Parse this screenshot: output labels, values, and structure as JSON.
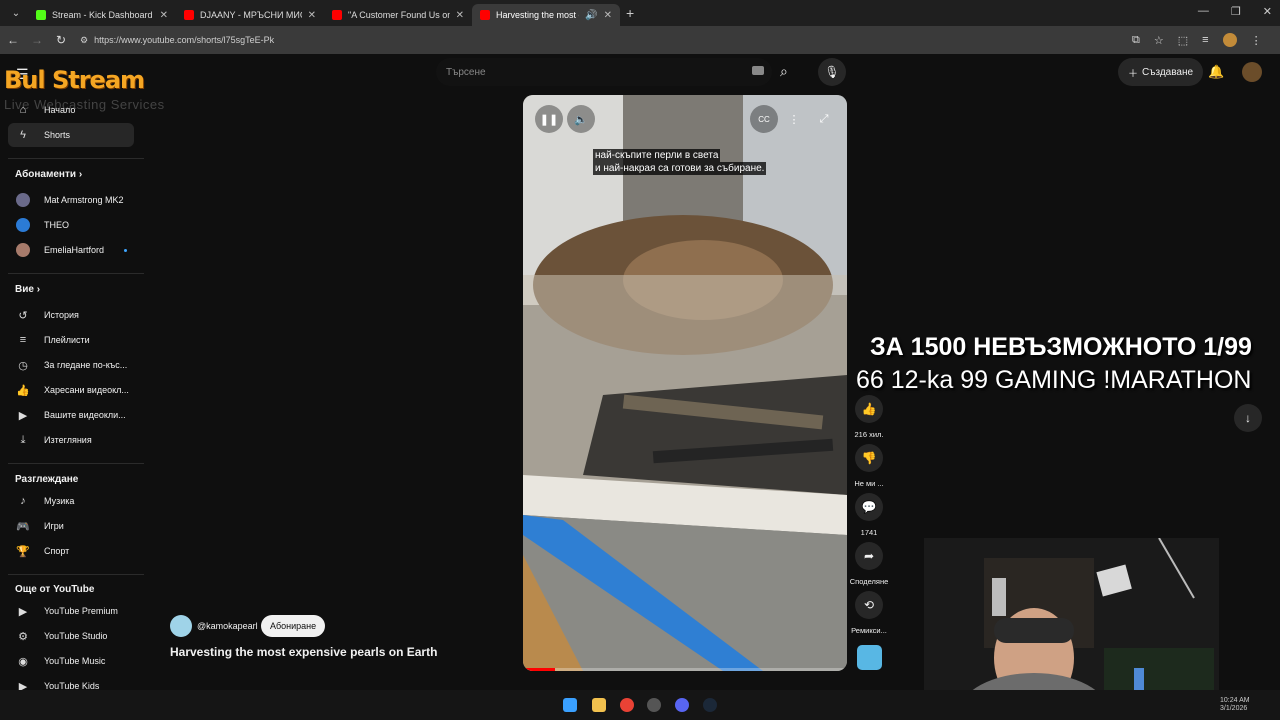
{
  "browser": {
    "tabs": [
      {
        "title": "Stream - Kick Dashboard",
        "color": "#53fc18"
      },
      {
        "title": "DJAANY - МРЪСНИ МИСЛИ (с",
        "color": "#ff0000"
      },
      {
        "title": "\"A Customer Found Us on Yelp",
        "color": "#ff0000"
      },
      {
        "title": "Harvesting the most expen",
        "color": "#ff0000",
        "active": true
      }
    ],
    "url": "https://www.youtube.com/shorts/l75sgTeE-Pk"
  },
  "header": {
    "logo_text": "Bul Stream",
    "logo_sub": "Live Webcasting Services",
    "search_placeholder": "Търсене",
    "create_label": "Създаване"
  },
  "sidebar": {
    "main": [
      {
        "label": "Начало",
        "icon": "home-icon"
      },
      {
        "label": "Shorts",
        "icon": "shorts-icon",
        "active": true
      }
    ],
    "subs_heading": "Абонаменти",
    "subs": [
      {
        "label": "Mat Armstrong MK2",
        "color": "#6a6a8a"
      },
      {
        "label": "THEO",
        "color": "#2b7bd6"
      },
      {
        "label": "EmeliaHartford",
        "color": "#a77b6b"
      }
    ],
    "you_heading": "Вие",
    "you": [
      {
        "label": "История",
        "icon": "history-icon"
      },
      {
        "label": "Плейлисти",
        "icon": "playlist-icon"
      },
      {
        "label": "За гледане по-къс...",
        "icon": "clock-icon"
      },
      {
        "label": "Харесани видеокл...",
        "icon": "like-icon"
      },
      {
        "label": "Вашите видеокли...",
        "icon": "video-icon"
      },
      {
        "label": "Изтегляния",
        "icon": "download-icon"
      }
    ],
    "explore_heading": "Разглеждане",
    "explore": [
      {
        "label": "Музика",
        "icon": "music-icon"
      },
      {
        "label": "Игри",
        "icon": "gaming-icon"
      },
      {
        "label": "Спорт",
        "icon": "trophy-icon"
      }
    ],
    "more_heading": "Още от YouTube",
    "more": [
      {
        "label": "YouTube Premium"
      },
      {
        "label": "YouTube Studio"
      },
      {
        "label": "YouTube Music"
      },
      {
        "label": "YouTube Kids"
      }
    ]
  },
  "video": {
    "caption_line1": "най-скъпите перли в света",
    "caption_line2": "и най-накрая са готови за събиране.",
    "progress": 0.1,
    "cc_label": "CC"
  },
  "actions": {
    "likes": "216 хил.",
    "dislike": "Не ми ...",
    "comments": "1741",
    "share": "Споделяне",
    "remix": "Ремикси..."
  },
  "channel": {
    "handle": "@kamokapearl",
    "subscribe_label": "Абониране",
    "title": "Harvesting the most expensive pearls on Earth"
  },
  "overlay": {
    "line1": "ЗА 1500 НЕВЪЗМОЖНОТО 1/99",
    "line2": "66 12-ka 99 GAMING !MARATHON"
  },
  "taskbar": {
    "time": "10:24 AM",
    "date": "3/1/2026"
  }
}
